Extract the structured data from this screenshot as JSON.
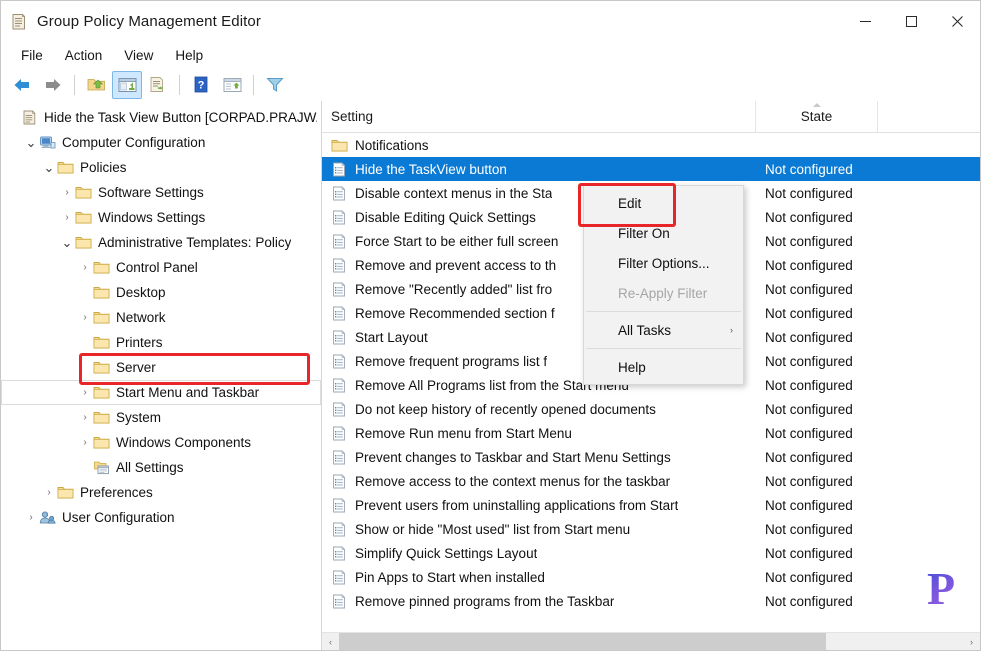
{
  "window": {
    "title": "Group Policy Management Editor",
    "icon": "console-window-icon",
    "minimize": "─",
    "maximize": "☐",
    "close": "✕"
  },
  "menubar": {
    "items": [
      {
        "label": "File",
        "name": "menu-file"
      },
      {
        "label": "Action",
        "name": "menu-action"
      },
      {
        "label": "View",
        "name": "menu-view"
      },
      {
        "label": "Help",
        "name": "menu-help"
      }
    ]
  },
  "toolbar": {
    "buttons": [
      {
        "name": "back-button",
        "icon": "back-arrow-icon",
        "active": false
      },
      {
        "name": "forward-button",
        "icon": "forward-arrow-icon",
        "active": false
      },
      {
        "name": "up-one-level-button",
        "icon": "folder-up-icon",
        "active": false
      },
      {
        "name": "show-hide-console-tree-button",
        "icon": "console-tree-icon",
        "active": true
      },
      {
        "name": "export-list-button",
        "icon": "export-list-icon",
        "active": false
      },
      {
        "name": "help-button",
        "icon": "help-question-icon",
        "active": false
      },
      {
        "name": "properties-button",
        "icon": "properties-window-icon",
        "active": false
      },
      {
        "name": "filter-button",
        "icon": "funnel-filter-icon",
        "active": false
      }
    ]
  },
  "tree": {
    "root_label": "Hide the Task View Button [CORPAD.PRAJW/",
    "items": [
      {
        "label": "Hide the Task View Button [CORPAD.PRAJW/",
        "indent": 0,
        "twisty": "",
        "icon": "console-root-icon",
        "name": "tree-item-root"
      },
      {
        "label": "Computer Configuration",
        "indent": 1,
        "twisty": "open",
        "icon": "computer-icon",
        "name": "tree-item-computer-configuration"
      },
      {
        "label": "Policies",
        "indent": 2,
        "twisty": "open",
        "icon": "folder-icon",
        "name": "tree-item-policies"
      },
      {
        "label": "Software Settings",
        "indent": 3,
        "twisty": "closed",
        "icon": "folder-icon",
        "name": "tree-item-software-settings"
      },
      {
        "label": "Windows Settings",
        "indent": 3,
        "twisty": "closed",
        "icon": "folder-icon",
        "name": "tree-item-windows-settings"
      },
      {
        "label": "Administrative Templates: Policy",
        "indent": 3,
        "twisty": "open",
        "icon": "folder-icon",
        "name": "tree-item-administrative-templates"
      },
      {
        "label": "Control Panel",
        "indent": 4,
        "twisty": "closed",
        "icon": "folder-icon",
        "name": "tree-item-control-panel"
      },
      {
        "label": "Desktop",
        "indent": 4,
        "twisty": "",
        "icon": "folder-icon",
        "name": "tree-item-desktop"
      },
      {
        "label": "Network",
        "indent": 4,
        "twisty": "closed",
        "icon": "folder-icon",
        "name": "tree-item-network"
      },
      {
        "label": "Printers",
        "indent": 4,
        "twisty": "",
        "icon": "folder-icon",
        "name": "tree-item-printers"
      },
      {
        "label": "Server",
        "indent": 4,
        "twisty": "",
        "icon": "folder-icon",
        "name": "tree-item-server"
      },
      {
        "label": "Start Menu and Taskbar",
        "indent": 4,
        "twisty": "closed",
        "icon": "folder-icon",
        "name": "tree-item-start-menu-and-taskbar",
        "highlighted": true
      },
      {
        "label": "System",
        "indent": 4,
        "twisty": "closed",
        "icon": "folder-icon",
        "name": "tree-item-system"
      },
      {
        "label": "Windows Components",
        "indent": 4,
        "twisty": "closed",
        "icon": "folder-icon",
        "name": "tree-item-windows-components"
      },
      {
        "label": "All Settings",
        "indent": 4,
        "twisty": "",
        "icon": "all-settings-icon",
        "name": "tree-item-all-settings"
      },
      {
        "label": "Preferences",
        "indent": 2,
        "twisty": "closed",
        "icon": "folder-icon",
        "name": "tree-item-preferences"
      },
      {
        "label": "User Configuration",
        "indent": 1,
        "twisty": "closed",
        "icon": "user-icon",
        "name": "tree-item-user-configuration"
      }
    ]
  },
  "list": {
    "columns": [
      {
        "label": "Setting",
        "name": "column-header-setting"
      },
      {
        "label": "State",
        "name": "column-header-state"
      },
      {
        "label": "",
        "name": "column-header-comment"
      }
    ],
    "rows": [
      {
        "setting": "Notifications",
        "state": "",
        "icon": "folder-icon",
        "selected": false
      },
      {
        "setting": "Hide the TaskView button",
        "state": "Not configured",
        "icon": "policy-setting-icon",
        "selected": true
      },
      {
        "setting": "Disable context menus in the Sta",
        "state": "Not configured",
        "icon": "policy-setting-icon",
        "selected": false
      },
      {
        "setting": "Disable Editing Quick Settings",
        "state": "Not configured",
        "icon": "policy-setting-icon",
        "selected": false
      },
      {
        "setting": "Force Start to be either full screen",
        "state": "Not configured",
        "icon": "policy-setting-icon",
        "selected": false
      },
      {
        "setting": "Remove and prevent access to th",
        "state": "Not configured",
        "icon": "policy-setting-icon",
        "selected": false
      },
      {
        "setting": "Remove \"Recently added\" list fro",
        "state": "Not configured",
        "icon": "policy-setting-icon",
        "selected": false
      },
      {
        "setting": "Remove Recommended section f",
        "state": "Not configured",
        "icon": "policy-setting-icon",
        "selected": false
      },
      {
        "setting": "Start Layout",
        "state": "Not configured",
        "icon": "policy-setting-icon",
        "selected": false
      },
      {
        "setting": "Remove frequent programs list f",
        "state": "Not configured",
        "icon": "policy-setting-icon",
        "selected": false
      },
      {
        "setting": "Remove All Programs list from the Start menu",
        "state": "Not configured",
        "icon": "policy-setting-icon",
        "selected": false
      },
      {
        "setting": "Do not keep history of recently opened documents",
        "state": "Not configured",
        "icon": "policy-setting-icon",
        "selected": false
      },
      {
        "setting": "Remove Run menu from Start Menu",
        "state": "Not configured",
        "icon": "policy-setting-icon",
        "selected": false
      },
      {
        "setting": "Prevent changes to Taskbar and Start Menu Settings",
        "state": "Not configured",
        "icon": "policy-setting-icon",
        "selected": false
      },
      {
        "setting": "Remove access to the context menus for the taskbar",
        "state": "Not configured",
        "icon": "policy-setting-icon",
        "selected": false
      },
      {
        "setting": "Prevent users from uninstalling applications from Start",
        "state": "Not configured",
        "icon": "policy-setting-icon",
        "selected": false
      },
      {
        "setting": "Show or hide \"Most used\" list from Start menu",
        "state": "Not configured",
        "icon": "policy-setting-icon",
        "selected": false
      },
      {
        "setting": "Simplify Quick Settings Layout",
        "state": "Not configured",
        "icon": "policy-setting-icon",
        "selected": false
      },
      {
        "setting": "Pin Apps to Start when installed",
        "state": "Not configured",
        "icon": "policy-setting-icon",
        "selected": false
      },
      {
        "setting": "Remove pinned programs from the Taskbar",
        "state": "Not configured",
        "icon": "policy-setting-icon",
        "selected": false
      }
    ]
  },
  "context_menu": {
    "items": [
      {
        "label": "Edit",
        "name": "context-menu-edit",
        "disabled": false,
        "submenu": false,
        "highlighted": true
      },
      {
        "label": "Filter On",
        "name": "context-menu-filter-on",
        "disabled": false,
        "submenu": false
      },
      {
        "label": "Filter Options...",
        "name": "context-menu-filter-options",
        "disabled": false,
        "submenu": false
      },
      {
        "label": "Re-Apply Filter",
        "name": "context-menu-re-apply-filter",
        "disabled": true,
        "submenu": false
      },
      {
        "separator": true
      },
      {
        "label": "All Tasks",
        "name": "context-menu-all-tasks",
        "disabled": false,
        "submenu": true
      },
      {
        "separator": true
      },
      {
        "label": "Help",
        "name": "context-menu-help",
        "disabled": false,
        "submenu": false
      }
    ],
    "submenu_arrow": "›"
  },
  "scrollbar": {
    "left_arrow": "‹",
    "right_arrow": "›"
  },
  "watermark": {
    "letter": "P"
  },
  "colors": {
    "selection_blue": "#0b7ad4",
    "annotation_red": "#e8262a",
    "toolbar_active": "#cde8ff",
    "folder_yellow": "#f6d98b",
    "watermark_purple": "#6b4fd8"
  }
}
